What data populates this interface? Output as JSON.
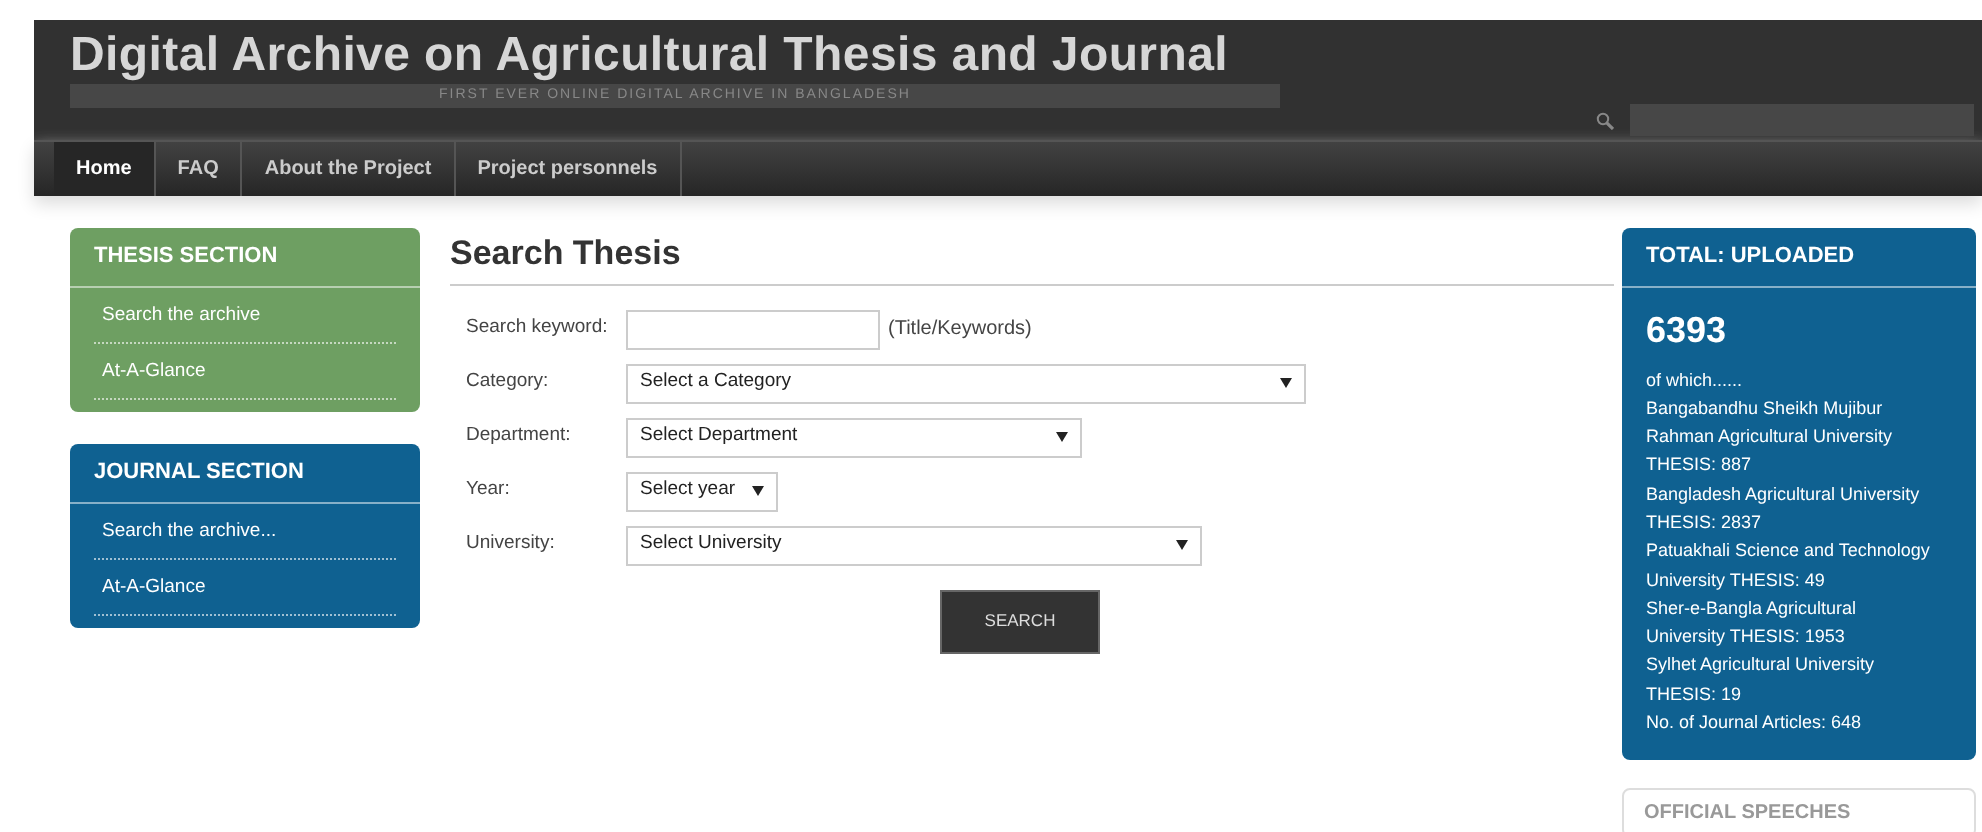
{
  "header": {
    "title": "Digital Archive on Agricultural Thesis and Journal",
    "tagline": "FIRST EVER ONLINE DIGITAL ARCHIVE IN BANGLADESH"
  },
  "nav": [
    {
      "label": "Home",
      "selected": true
    },
    {
      "label": "FAQ",
      "selected": false
    },
    {
      "label": "About the Project",
      "selected": false
    },
    {
      "label": "Project personnels",
      "selected": false
    }
  ],
  "sidebar": [
    {
      "title": "THESIS SECTION",
      "color": "#6e9f62",
      "links": [
        "Search the archive",
        "At-A-Glance"
      ]
    },
    {
      "title": "JOURNAL SECTION",
      "color": "#0f6191",
      "links": [
        "Search the archive...",
        "At-A-Glance"
      ]
    }
  ],
  "main": {
    "title": "Search Thesis",
    "fields": [
      {
        "kind": "input",
        "label": "Search keyword:",
        "hint": "(Title/Keywords)"
      },
      {
        "kind": "select",
        "label": "Category:",
        "value": "Select a Category"
      },
      {
        "kind": "select",
        "label": "Department:",
        "value": "Select Department"
      },
      {
        "kind": "select",
        "label": "Year:",
        "value": "Select year"
      },
      {
        "kind": "select",
        "label": "University:",
        "value": "Select University"
      }
    ],
    "button": "SEARCH"
  },
  "total": {
    "title": "TOTAL: UPLOADED",
    "count": "6393",
    "lines": [
      "of which......",
      "Bangabandhu Sheikh Mujibur",
      "Rahman Agricultural University",
      "THESIS: 887",
      "Bangladesh Agricultural University",
      "THESIS: 2837",
      "Patuakhali Science and Technology",
      "University THESIS: 49",
      "Sher-e-Bangla Agricultural",
      "University THESIS: 1953",
      "Sylhet Agricultural University",
      "THESIS: 19",
      "No. of Journal Articles: 648"
    ]
  },
  "speeches": {
    "title": "OFFICIAL SPEECHES"
  }
}
